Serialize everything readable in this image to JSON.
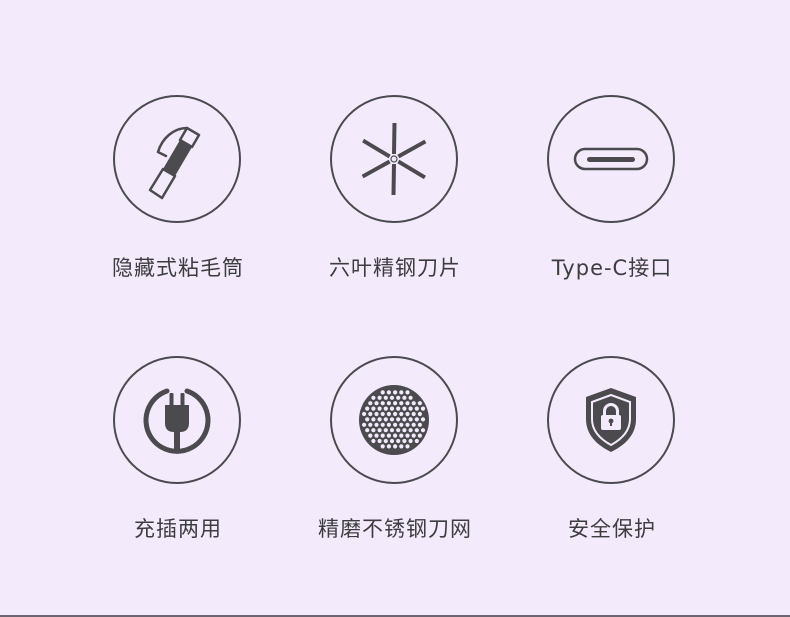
{
  "features": [
    {
      "icon": "lint-roller-icon",
      "label": "隐藏式粘毛筒"
    },
    {
      "icon": "six-blade-icon",
      "label": "六叶精钢刀片"
    },
    {
      "icon": "type-c-port-icon",
      "label": "Type-C接口"
    },
    {
      "icon": "plug-icon",
      "label": "充插两用"
    },
    {
      "icon": "mesh-icon",
      "label": "精磨不锈钢刀网"
    },
    {
      "icon": "shield-lock-icon",
      "label": "安全保护"
    }
  ],
  "colors": {
    "background": "#f3eafb",
    "icon": "#4b4b4f",
    "text": "#3d3d40"
  }
}
